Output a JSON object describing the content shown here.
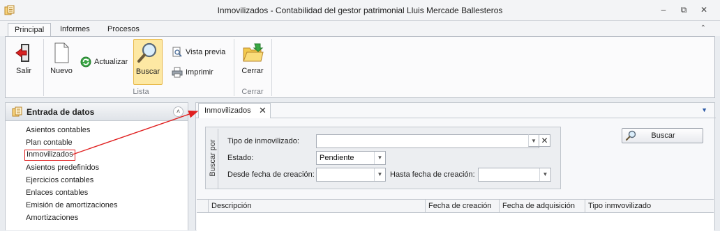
{
  "window": {
    "title": "Inmovilizados - Contabilidad del gestor patrimonial Lluis Mercade Ballesteros",
    "minimize_glyph": "–",
    "restore_glyph": "⧉",
    "close_glyph": "✕"
  },
  "ribbon": {
    "tabs": [
      {
        "label": "Principal",
        "active": true
      },
      {
        "label": "Informes",
        "active": false
      },
      {
        "label": "Procesos",
        "active": false
      }
    ],
    "collapse_glyph": "⌃",
    "buttons": {
      "salir": "Salir",
      "nuevo": "Nuevo",
      "actualizar": "Actualizar",
      "buscar": "Buscar",
      "vista_previa": "Vista previa",
      "imprimir": "Imprimir",
      "cerrar": "Cerrar"
    },
    "groups": {
      "lista": "Lista",
      "cerrar": "Cerrar"
    }
  },
  "left_panel": {
    "title": "Entrada de datos",
    "collapse_glyph": "˄",
    "items": [
      {
        "label": "Asientos contables",
        "highlighted": false
      },
      {
        "label": "Plan contable",
        "highlighted": false
      },
      {
        "label": "Inmovilizados",
        "highlighted": true
      },
      {
        "label": "Asientos predefinidos",
        "highlighted": false
      },
      {
        "label": "Ejercicios contables",
        "highlighted": false
      },
      {
        "label": "Enlaces contables",
        "highlighted": false
      },
      {
        "label": "Emisión de amortizaciones",
        "highlighted": false
      },
      {
        "label": "Amortizaciones",
        "highlighted": false
      }
    ]
  },
  "document": {
    "tab_label": "Inmovilizados",
    "tab_close_glyph": "✕",
    "tab_dropdown_glyph": "▼",
    "search": {
      "group_label": "Buscar por",
      "tipo_label": "Tipo de inmovilizado:",
      "tipo_value": "",
      "estado_label": "Estado:",
      "estado_value": "Pendiente",
      "desde_label": "Desde fecha de creación:",
      "desde_value": "",
      "hasta_label": "Hasta fecha de creación:",
      "hasta_value": "",
      "dropdown_glyph": "▼",
      "clear_glyph": "✕",
      "buscar_button": "Buscar"
    },
    "grid": {
      "columns": [
        "Descripción",
        "Fecha de creación",
        "Fecha de adquisición",
        "Tipo inmvovilizado"
      ],
      "rows": []
    }
  },
  "colors": {
    "accent": "#fde8a3",
    "annotation": "#e02020"
  }
}
